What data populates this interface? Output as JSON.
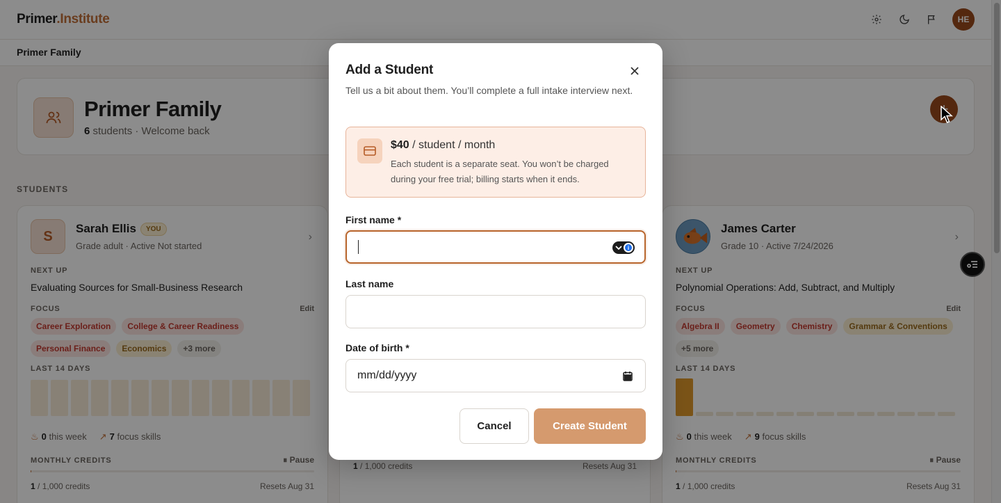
{
  "app": {
    "logo_primary": "Primer",
    "logo_accent": ".Institute",
    "avatar_initials": "HE",
    "subnav_title": "Primer Family"
  },
  "family": {
    "title": "Primer Family",
    "count": "6",
    "sub_rest": "students · Welcome back",
    "add_label": "+"
  },
  "students_label": "STUDENTS",
  "students": [
    {
      "initial": "S",
      "name": "Sarah Ellis",
      "badge": "YOU",
      "meta": "Grade adult  ·  Active Not started",
      "next_up_label": "NEXT UP",
      "next_up": "Evaluating Sources for Small-Business Research",
      "focus_label": "FOCUS",
      "edit": "Edit",
      "tags": [
        "Career Exploration",
        "College & Career Readiness",
        "Personal Finance",
        "Economics",
        "+3 more"
      ],
      "last_label": "LAST 14 DAYS",
      "week_count": "0",
      "week_text": "this week",
      "skills_count": "7",
      "skills_text": "focus skills",
      "credits_label": "MONTHLY CREDITS",
      "pause": "Pause",
      "credits_used": "1",
      "credits_total": "/ 1,000 credits",
      "credits_fraction": 0.001,
      "resets": "Resets Aug 31"
    },
    {
      "credits_used": "1",
      "credits_total": "/ 1,000 credits",
      "resets": "Resets Aug 31"
    },
    {
      "name": "James Carter",
      "meta": "Grade 10  ·  Active 7/24/2026",
      "next_up_label": "NEXT UP",
      "next_up": "Polynomial Operations: Add, Subtract, and Multiply",
      "focus_label": "FOCUS",
      "edit": "Edit",
      "tags": [
        "Algebra II",
        "Geometry",
        "Chemistry",
        "Grammar & Conventions",
        "+5 more"
      ],
      "last_label": "LAST 14 DAYS",
      "week_count": "0",
      "week_text": "this week",
      "skills_count": "9",
      "skills_text": "focus skills",
      "credits_label": "MONTHLY CREDITS",
      "pause": "Pause",
      "credits_used": "1",
      "credits_total": "/ 1,000 credits",
      "credits_fraction": 0.001,
      "resets": "Resets Aug 31"
    }
  ],
  "modal": {
    "title": "Add a Student",
    "description": "Tell us a bit about them. You’ll complete a full intake interview next.",
    "price_amount": "$40",
    "price_unit": " / student / month",
    "price_note": "Each student is a separate seat. You won’t be charged during your free trial; billing starts when it ends.",
    "first_name_label": "First name *",
    "first_name_value": "",
    "last_name_label": "Last name",
    "last_name_value": "",
    "dob_label": "Date of birth *",
    "dob_placeholder": "mm/dd/yyyy",
    "cancel": "Cancel",
    "create": "Create Student"
  },
  "colors": {
    "accent": "#b8652c",
    "accent_soft": "#d59a6e",
    "avatar": "#9a4a1c"
  }
}
